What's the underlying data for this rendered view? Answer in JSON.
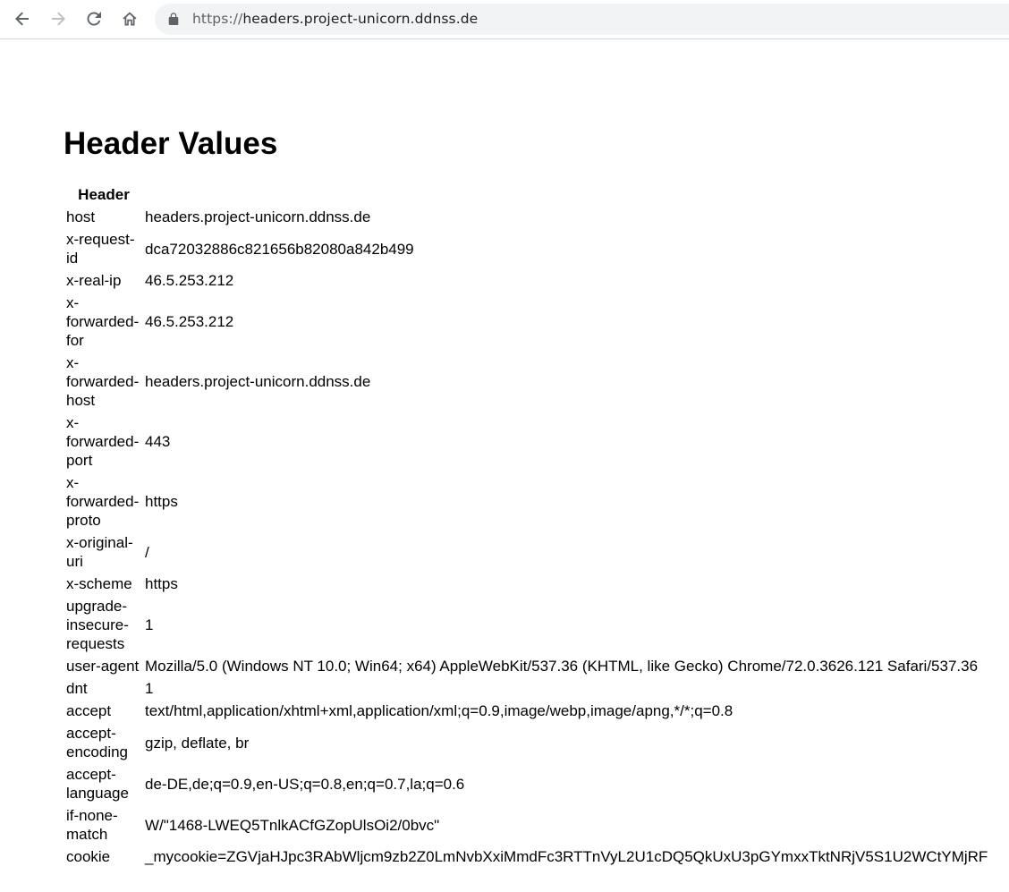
{
  "browser": {
    "url_scheme": "https://",
    "url_host": "headers.project-unicorn.ddnss.de"
  },
  "page": {
    "title": "Header Values",
    "table": {
      "header_label": "Header",
      "rows": [
        {
          "key": "host",
          "value": "headers.project-unicorn.ddnss.de"
        },
        {
          "key": "x-request-id",
          "value": "dca72032886c821656b82080a842b499"
        },
        {
          "key": "x-real-ip",
          "value": "46.5.253.212"
        },
        {
          "key": "x-forwarded-for",
          "value": "46.5.253.212"
        },
        {
          "key": "x-forwarded-host",
          "value": "headers.project-unicorn.ddnss.de"
        },
        {
          "key": "x-forwarded-port",
          "value": "443"
        },
        {
          "key": "x-forwarded-proto",
          "value": "https"
        },
        {
          "key": "x-original-uri",
          "value": "/"
        },
        {
          "key": "x-scheme",
          "value": "https"
        },
        {
          "key": "upgrade-insecure-requests",
          "value": "1"
        },
        {
          "key": "user-agent",
          "value": "Mozilla/5.0 (Windows NT 10.0; Win64; x64) AppleWebKit/537.36 (KHTML, like Gecko) Chrome/72.0.3626.121 Safari/537.36"
        },
        {
          "key": "dnt",
          "value": "1"
        },
        {
          "key": "accept",
          "value": "text/html,application/xhtml+xml,application/xml;q=0.9,image/webp,image/apng,*/*;q=0.8"
        },
        {
          "key": "accept-encoding",
          "value": "gzip, deflate, br"
        },
        {
          "key": "accept-language",
          "value": "de-DE,de;q=0.9,en-US;q=0.8,en;q=0.7,la;q=0.6"
        },
        {
          "key": "if-none-match",
          "value": "W/\"1468-LWEQ5TnlkACfGZopUlsOi2/0bvc\""
        },
        {
          "key": "cookie",
          "value": "_mycookie=ZGVjaHJpc3RAbWljcm9zb2Z0LmNvbXxiMmdFc3RTTnVyL2U1cDQ5QkUxU3pGYmxxTktNRjV5S1U2WCtYMjRF"
        }
      ]
    }
  },
  "icons": {
    "back": "arrow-left-icon",
    "forward": "arrow-right-icon",
    "reload": "reload-icon",
    "home": "home-icon",
    "lock": "lock-icon"
  },
  "colors": {
    "toolbar_icon": "#5f6368",
    "toolbar_icon_disabled": "#bdc1c6",
    "omnibox_bg": "#f1f3f4"
  }
}
